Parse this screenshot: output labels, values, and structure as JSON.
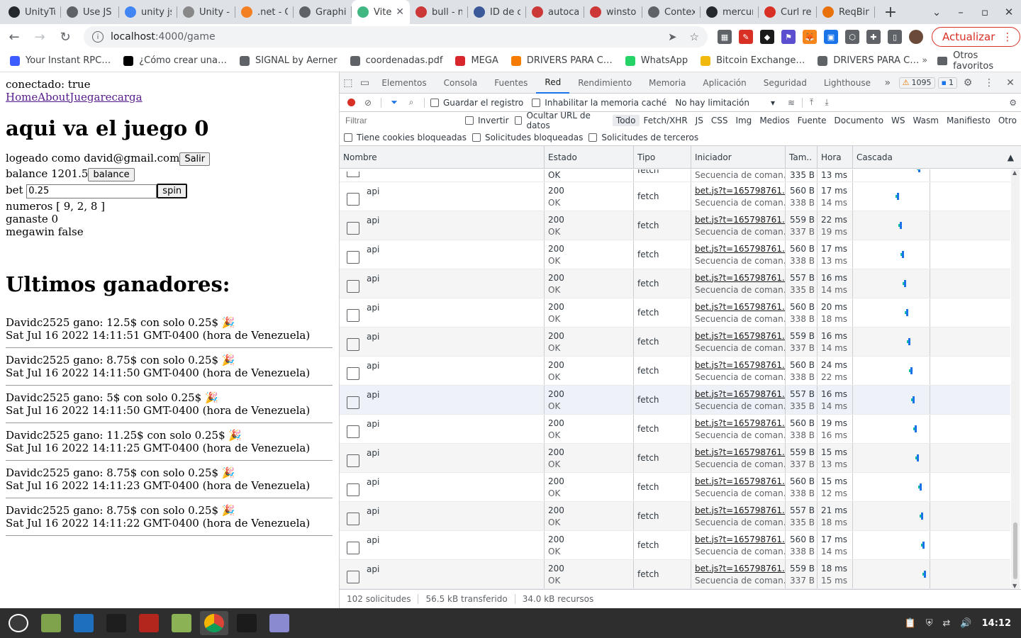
{
  "browser": {
    "tabs": [
      {
        "label": "UnityTu",
        "icon": "github-icon",
        "color": "#24292e"
      },
      {
        "label": "Use JS",
        "icon": "globe-icon",
        "color": "#5f6368"
      },
      {
        "label": "unity js",
        "icon": "google-icon",
        "color": "#4285f4"
      },
      {
        "label": "Unity -",
        "icon": "unity-icon",
        "color": "#888888"
      },
      {
        "label": ".net - C",
        "icon": "stackoverflow-icon",
        "color": "#f48024"
      },
      {
        "label": "Graphi",
        "icon": "globe-icon",
        "color": "#5f6368"
      },
      {
        "label": "Vite",
        "icon": "vue-icon",
        "color": "#41b883",
        "active": true
      },
      {
        "label": "bull - n",
        "icon": "npm-icon",
        "color": "#cb3837"
      },
      {
        "label": "ID de c",
        "icon": "api-icon",
        "color": "#3b5998"
      },
      {
        "label": "autoca",
        "icon": "npm-icon",
        "color": "#cb3837"
      },
      {
        "label": "winsto",
        "icon": "npm-icon",
        "color": "#cb3837"
      },
      {
        "label": "Contex",
        "icon": "globe-icon",
        "color": "#5f6368"
      },
      {
        "label": "mercur",
        "icon": "github-icon",
        "color": "#24292e"
      },
      {
        "label": "Curl re",
        "icon": "curl-icon",
        "color": "#d93025"
      },
      {
        "label": "ReqBin",
        "icon": "reqbin-icon",
        "color": "#e8710a"
      }
    ],
    "url_host": "localhost",
    "url_path": ":4000/game",
    "update_label": "Actualizar",
    "bookmarks": [
      {
        "label": "Your Instant RPC…",
        "color": "#3c5cff"
      },
      {
        "label": "¿Cómo crear una…",
        "color": "#000000"
      },
      {
        "label": "SIGNAL by Aerner",
        "color": "#5f6368"
      },
      {
        "label": "coordenadas.pdf",
        "color": "#5f6368"
      },
      {
        "label": "MEGA",
        "color": "#d9272e"
      },
      {
        "label": "DRIVERS PARA C…",
        "color": "#f57c00"
      },
      {
        "label": "WhatsApp",
        "color": "#25d366"
      },
      {
        "label": "Bitcoin Exchange…",
        "color": "#f0b90b"
      },
      {
        "label": "DRIVERS PARA C…",
        "color": "#5f6368"
      }
    ],
    "other_bookmarks": "Otros favoritos"
  },
  "page": {
    "connected": "conectado: true",
    "nav": [
      "Home",
      "About",
      "Juegar",
      "ecarga"
    ],
    "heading": "aqui va el juego 0",
    "logged": "logeado como david@gmail.com",
    "logout_label": "Salir",
    "balance": "balance 1201.5",
    "balance_label": "balance",
    "bet_label": "bet",
    "bet_value": "0.25",
    "spin_label": "spin",
    "numbers": "numeros [ 9, 2, 8 ]",
    "won": "ganaste 0",
    "megawin": "megawin false",
    "winners_heading": "Ultimos ganadores:",
    "winners": [
      {
        "line": "Davidc2525 gano: 12.5$ con solo 0.25$ 🎉",
        "date": "Sat Jul 16 2022 14:11:51 GMT-0400 (hora de Venezuela)"
      },
      {
        "line": "Davidc2525 gano: 8.75$ con solo 0.25$ 🎉",
        "date": "Sat Jul 16 2022 14:11:50 GMT-0400 (hora de Venezuela)"
      },
      {
        "line": "Davidc2525 gano: 5$ con solo 0.25$ 🎉",
        "date": "Sat Jul 16 2022 14:11:50 GMT-0400 (hora de Venezuela)"
      },
      {
        "line": "Davidc2525 gano: 11.25$ con solo 0.25$ 🎉",
        "date": "Sat Jul 16 2022 14:11:25 GMT-0400 (hora de Venezuela)"
      },
      {
        "line": "Davidc2525 gano: 8.75$ con solo 0.25$ 🎉",
        "date": "Sat Jul 16 2022 14:11:23 GMT-0400 (hora de Venezuela)"
      },
      {
        "line": "Davidc2525 gano: 8.75$ con solo 0.25$ 🎉",
        "date": "Sat Jul 16 2022 14:11:22 GMT-0400 (hora de Venezuela)"
      }
    ]
  },
  "devtools": {
    "tabs": [
      "Elementos",
      "Consola",
      "Fuentes",
      "Red",
      "Rendimiento",
      "Memoria",
      "Aplicación",
      "Seguridad",
      "Lighthouse"
    ],
    "active_tab": "Red",
    "warnings": "1095",
    "messages": "1",
    "preserve_log": "Guardar el registro",
    "disable_cache": "Inhabilitar la memoria caché",
    "throttling": "No hay limitación",
    "filter_placeholder": "Filtrar",
    "invert": "Invertir",
    "hide_data_urls": "Ocultar URL de datos",
    "filter_types": [
      "Todo",
      "Fetch/XHR",
      "JS",
      "CSS",
      "Img",
      "Medios",
      "Fuente",
      "Documento",
      "WS",
      "Wasm",
      "Manifiesto",
      "Otro"
    ],
    "blocked_cookies": "Tiene cookies bloqueadas",
    "blocked_requests": "Solicitudes bloqueadas",
    "third_party": "Solicitudes de terceros",
    "columns": {
      "name": "Nombre",
      "status": "Estado",
      "type": "Tipo",
      "initiator": "Iniciador",
      "size": "Tam..",
      "time": "Hora",
      "waterfall": "Cascada"
    },
    "partial_row": {
      "status": "OK",
      "type": "fetch",
      "initiator": "Secuencia de coman...",
      "size": "335 B",
      "time": "13 ms"
    },
    "requests": [
      {
        "name": "api",
        "status": "200",
        "status_text": "OK",
        "type": "fetch",
        "initiator": "bet.js?t=165798761...",
        "initiator2": "Secuencia de coman...",
        "size1": "560 B",
        "size2": "338 B",
        "time1": "17 ms",
        "time2": "14 ms",
        "wf": 0.6
      },
      {
        "name": "api",
        "status": "200",
        "status_text": "OK",
        "type": "fetch",
        "initiator": "bet.js?t=165798761...",
        "initiator2": "Secuencia de coman...",
        "size1": "559 B",
        "size2": "337 B",
        "time1": "22 ms",
        "time2": "19 ms",
        "wf": 0.63
      },
      {
        "name": "api",
        "status": "200",
        "status_text": "OK",
        "type": "fetch",
        "initiator": "bet.js?t=165798761...",
        "initiator2": "Secuencia de coman...",
        "size1": "560 B",
        "size2": "338 B",
        "time1": "17 ms",
        "time2": "13 ms",
        "wf": 0.66
      },
      {
        "name": "api",
        "status": "200",
        "status_text": "OK",
        "type": "fetch",
        "initiator": "bet.js?t=165798761...",
        "initiator2": "Secuencia de coman...",
        "size1": "557 B",
        "size2": "335 B",
        "time1": "16 ms",
        "time2": "14 ms",
        "wf": 0.69
      },
      {
        "name": "api",
        "status": "200",
        "status_text": "OK",
        "type": "fetch",
        "initiator": "bet.js?t=165798761...",
        "initiator2": "Secuencia de coman...",
        "size1": "560 B",
        "size2": "338 B",
        "time1": "20 ms",
        "time2": "18 ms",
        "wf": 0.72
      },
      {
        "name": "api",
        "status": "200",
        "status_text": "OK",
        "type": "fetch",
        "initiator": "bet.js?t=165798761...",
        "initiator2": "Secuencia de coman...",
        "size1": "559 B",
        "size2": "337 B",
        "time1": "16 ms",
        "time2": "14 ms",
        "wf": 0.75
      },
      {
        "name": "api",
        "status": "200",
        "status_text": "OK",
        "type": "fetch",
        "initiator": "bet.js?t=165798761...",
        "initiator2": "Secuencia de coman...",
        "size1": "560 B",
        "size2": "338 B",
        "time1": "24 ms",
        "time2": "22 ms",
        "wf": 0.78
      },
      {
        "name": "api",
        "status": "200",
        "status_text": "OK",
        "type": "fetch",
        "initiator": "bet.js?t=165798761...",
        "initiator2": "Secuencia de coman...",
        "size1": "557 B",
        "size2": "335 B",
        "time1": "16 ms",
        "time2": "14 ms",
        "wf": 0.81,
        "highlight": true
      },
      {
        "name": "api",
        "status": "200",
        "status_text": "OK",
        "type": "fetch",
        "initiator": "bet.js?t=165798761...",
        "initiator2": "Secuencia de coman...",
        "size1": "560 B",
        "size2": "338 B",
        "time1": "19 ms",
        "time2": "16 ms",
        "wf": 0.84
      },
      {
        "name": "api",
        "status": "200",
        "status_text": "OK",
        "type": "fetch",
        "initiator": "bet.js?t=165798761...",
        "initiator2": "Secuencia de coman...",
        "size1": "559 B",
        "size2": "337 B",
        "time1": "15 ms",
        "time2": "13 ms",
        "wf": 0.87
      },
      {
        "name": "api",
        "status": "200",
        "status_text": "OK",
        "type": "fetch",
        "initiator": "bet.js?t=165798761...",
        "initiator2": "Secuencia de coman...",
        "size1": "560 B",
        "size2": "338 B",
        "time1": "15 ms",
        "time2": "12 ms",
        "wf": 0.9
      },
      {
        "name": "api",
        "status": "200",
        "status_text": "OK",
        "type": "fetch",
        "initiator": "bet.js?t=165798761...",
        "initiator2": "Secuencia de coman...",
        "size1": "557 B",
        "size2": "335 B",
        "time1": "21 ms",
        "time2": "18 ms",
        "wf": 0.92
      },
      {
        "name": "api",
        "status": "200",
        "status_text": "OK",
        "type": "fetch",
        "initiator": "bet.js?t=165798761...",
        "initiator2": "Secuencia de coman...",
        "size1": "560 B",
        "size2": "338 B",
        "time1": "17 ms",
        "time2": "14 ms",
        "wf": 0.94
      },
      {
        "name": "api",
        "status": "200",
        "status_text": "OK",
        "type": "fetch",
        "initiator": "bet.js?t=165798761...",
        "initiator2": "Secuencia de coman...",
        "size1": "559 B",
        "size2": "337 B",
        "time1": "18 ms",
        "time2": "15 ms",
        "wf": 0.96
      }
    ],
    "status_requests": "102 solicitudes",
    "status_transferred": "56.5 kB transferido",
    "status_resources": "34.0 kB recursos"
  },
  "taskbar": {
    "apps": [
      {
        "icon": "mint-menu-icon",
        "color": "#3a3a3a"
      },
      {
        "icon": "files-icon",
        "color": "#7ea34c"
      },
      {
        "icon": "vscode-icon",
        "color": "#1f6fbf"
      },
      {
        "icon": "system-monitor-icon",
        "color": "#1e1e1e"
      },
      {
        "icon": "terminal-red-icon",
        "color": "#b3261e"
      },
      {
        "icon": "folder-icon",
        "color": "#8bb355"
      },
      {
        "icon": "chrome-icon",
        "color": "#e8e8e8"
      },
      {
        "icon": "terminal-icon",
        "color": "#1b1b1b"
      },
      {
        "icon": "text-editor-icon",
        "color": "#8a8ad0"
      }
    ],
    "clock": "14:12"
  }
}
